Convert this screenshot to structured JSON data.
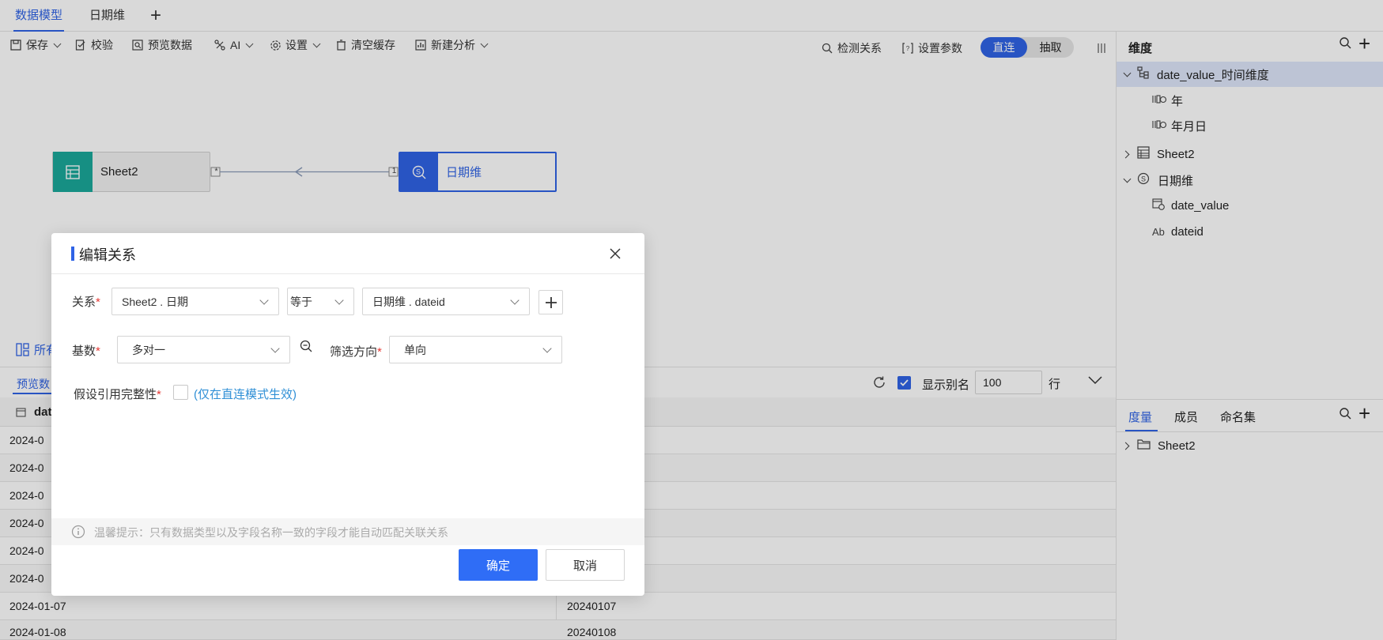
{
  "tabs": [
    {
      "label": "数据模型",
      "active": true
    },
    {
      "label": "日期维",
      "active": false
    }
  ],
  "toolbar": {
    "save": "保存",
    "validate": "校验",
    "preview": "预览数据",
    "ai": "AI",
    "settings": "设置",
    "clear_cache": "清空缓存",
    "new_analysis": "新建分析",
    "detect_relation": "检测关系",
    "set_params": "设置参数",
    "mode_direct": "直连",
    "mode_extract": "抽取"
  },
  "canvas": {
    "left_node": "Sheet2",
    "right_node": "日期维",
    "left_cardinality": "*",
    "right_cardinality": "1"
  },
  "bottom": {
    "tab_all": "所有",
    "tab_preview": "预览数",
    "col1_header": "dat",
    "show_alias": "显示别名",
    "row_count": "100",
    "row_unit": "行",
    "rows": [
      {
        "c1": "2024-0",
        "c2": ""
      },
      {
        "c1": "2024-0",
        "c2": ""
      },
      {
        "c1": "2024-0",
        "c2": ""
      },
      {
        "c1": "2024-0",
        "c2": ""
      },
      {
        "c1": "2024-0",
        "c2": ""
      },
      {
        "c1": "2024-0",
        "c2": ""
      },
      {
        "c1": "2024-01-07",
        "c2": "20240107"
      },
      {
        "c1": "2024-01-08",
        "c2": "20240108"
      }
    ]
  },
  "right_panel": {
    "dim_title": "维度",
    "tree": [
      {
        "label": "date_value_时间维度",
        "level": 0,
        "icon": "hierarchy-icon",
        "expanded": true,
        "selected": true
      },
      {
        "label": "年",
        "level": 1,
        "icon": "date-field-icon"
      },
      {
        "label": "年月日",
        "level": 1,
        "icon": "date-field-icon"
      },
      {
        "label": "Sheet2",
        "level": 0,
        "icon": "table-icon",
        "expanded": false
      },
      {
        "label": "日期维",
        "level": 0,
        "icon": "sql-icon",
        "expanded": true
      },
      {
        "label": "date_value",
        "level": 1,
        "icon": "calendar-icon"
      },
      {
        "label": "dateid",
        "level": 1,
        "icon": "text-field-icon",
        "icon_text": "Ab"
      }
    ],
    "measure_tabs": [
      "度量",
      "成员",
      "命名集"
    ],
    "measure_tree": [
      {
        "label": "Sheet2",
        "icon": "folder-icon"
      }
    ]
  },
  "dialog": {
    "title": "编辑关系",
    "relation_label": "关系",
    "relation_left": "Sheet2 . 日期",
    "relation_op": "等于",
    "relation_right": "日期维 . dateid",
    "cardinality_label": "基数",
    "cardinality_value": "多对一",
    "filter_dir_label": "筛选方向",
    "filter_dir_value": "单向",
    "integrity_label": "假设引用完整性",
    "integrity_note": "(仅在直连模式生效)",
    "tip": "温馨提示：只有数据类型以及字段名称一致的字段才能自动匹配关联关系",
    "ok": "确定",
    "cancel": "取消",
    "required_mark": "*"
  },
  "colors": {
    "accent": "#2f63e6",
    "teal": "#1aa89a",
    "required": "#e53935"
  }
}
